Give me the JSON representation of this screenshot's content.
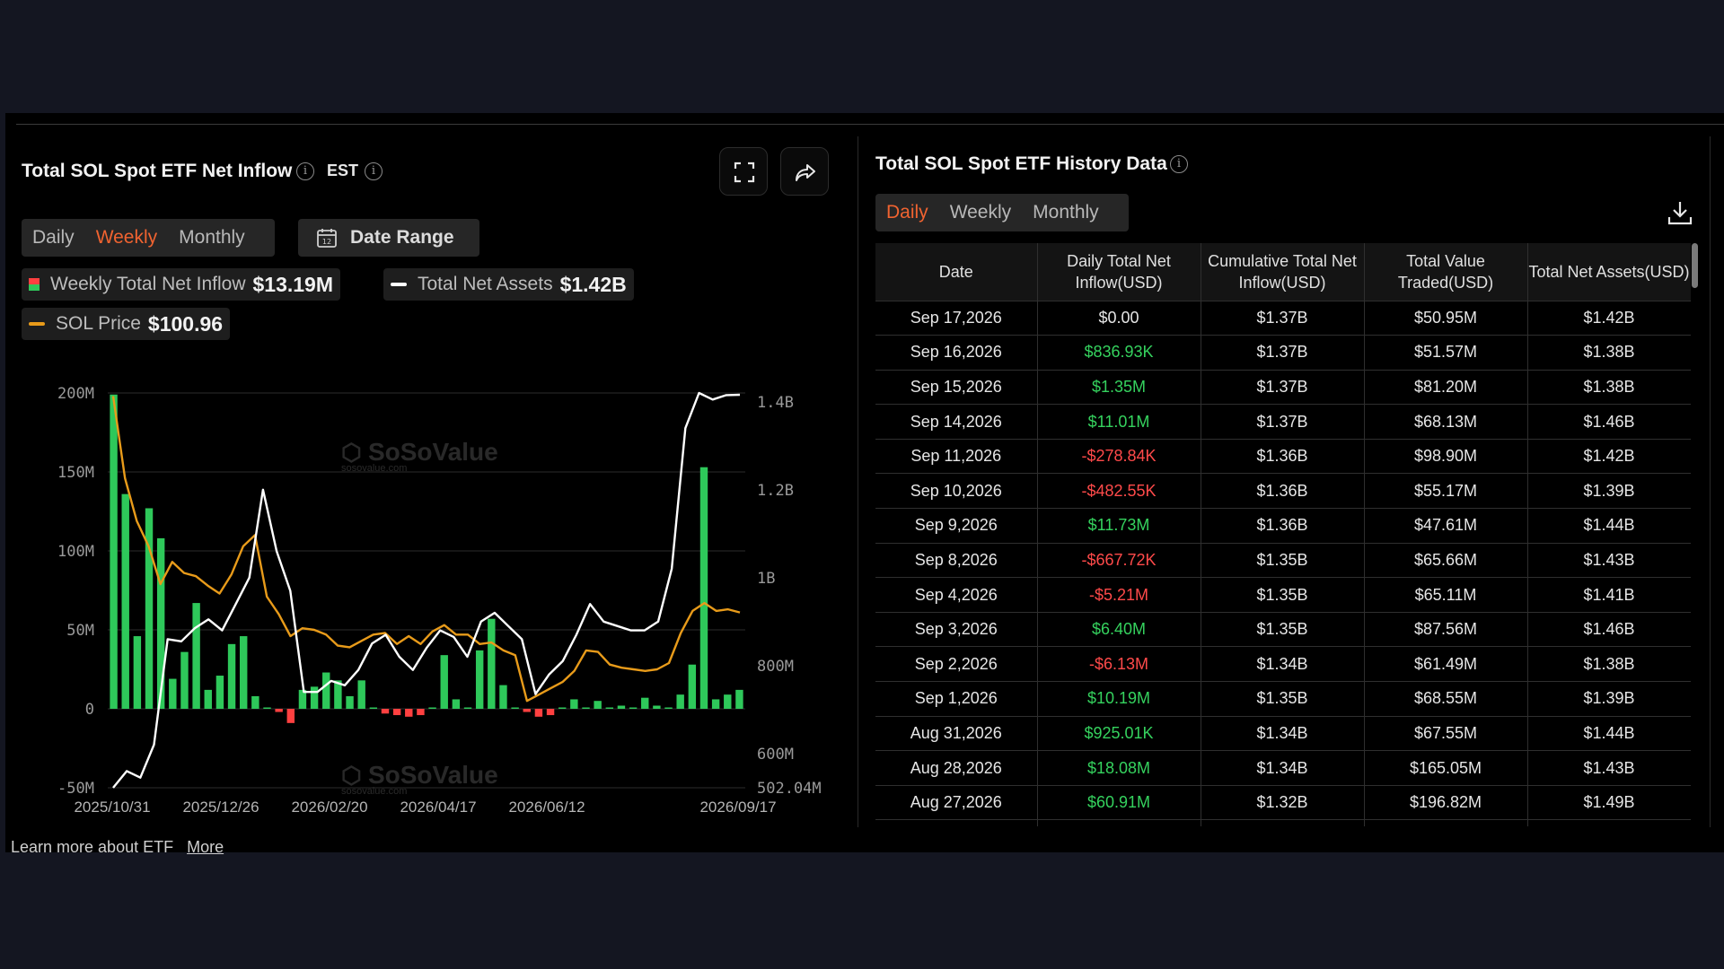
{
  "left_panel": {
    "title": "Total SOL Spot ETF Net Inflow",
    "timezone": "EST",
    "tabs": [
      "Daily",
      "Weekly",
      "Monthly"
    ],
    "active_tab": "Weekly",
    "date_range_label": "Date Range",
    "legend": {
      "inflow_name": "Weekly Total Net Inflow",
      "inflow_value": "$13.19M",
      "assets_name": "Total Net Assets",
      "assets_value": "$1.42B",
      "price_name": "SOL Price",
      "price_value": "$100.96"
    },
    "watermark": "SoSoValue",
    "watermark_sub": "sosovalue.com"
  },
  "right_panel": {
    "title": "Total SOL Spot ETF History Data",
    "tabs": [
      "Daily",
      "Weekly",
      "Monthly"
    ],
    "active_tab": "Daily",
    "columns": [
      "Date",
      "Daily Total Net Inflow(USD)",
      "Cumulative Total Net Inflow(USD)",
      "Total Value Traded(USD)",
      "Total Net Assets(USD)"
    ],
    "rows": [
      [
        "Sep 17,2026",
        "$0.00",
        "$1.37B",
        "$50.95M",
        "$1.42B"
      ],
      [
        "Sep 16,2026",
        "$836.93K",
        "$1.37B",
        "$51.57M",
        "$1.38B"
      ],
      [
        "Sep 15,2026",
        "$1.35M",
        "$1.37B",
        "$81.20M",
        "$1.38B"
      ],
      [
        "Sep 14,2026",
        "$11.01M",
        "$1.37B",
        "$68.13M",
        "$1.46B"
      ],
      [
        "Sep 11,2026",
        "-$278.84K",
        "$1.36B",
        "$98.90M",
        "$1.42B"
      ],
      [
        "Sep 10,2026",
        "-$482.55K",
        "$1.36B",
        "$55.17M",
        "$1.39B"
      ],
      [
        "Sep 9,2026",
        "$11.73M",
        "$1.36B",
        "$47.61M",
        "$1.44B"
      ],
      [
        "Sep 8,2026",
        "-$667.72K",
        "$1.35B",
        "$65.66M",
        "$1.43B"
      ],
      [
        "Sep 4,2026",
        "-$5.21M",
        "$1.35B",
        "$65.11M",
        "$1.41B"
      ],
      [
        "Sep 3,2026",
        "$6.40M",
        "$1.35B",
        "$87.56M",
        "$1.46B"
      ],
      [
        "Sep 2,2026",
        "-$6.13M",
        "$1.34B",
        "$61.49M",
        "$1.38B"
      ],
      [
        "Sep 1,2026",
        "$10.19M",
        "$1.35B",
        "$68.55M",
        "$1.39B"
      ],
      [
        "Aug 31,2026",
        "$925.01K",
        "$1.34B",
        "$67.55M",
        "$1.44B"
      ],
      [
        "Aug 28,2026",
        "$18.08M",
        "$1.34B",
        "$165.05M",
        "$1.43B"
      ],
      [
        "Aug 27,2026",
        "$60.91M",
        "$1.32B",
        "$196.82M",
        "$1.49B"
      ],
      [
        "",
        "",
        "",
        "",
        ""
      ]
    ]
  },
  "footer": {
    "text": "Learn more about ETF",
    "link": "More"
  },
  "colors": {
    "positive": "#2ec85a",
    "negative": "#ff4040",
    "assets_line": "#ffffff",
    "price_line": "#e89b1a",
    "active_tab": "#f06330"
  },
  "chart_data": {
    "type": "bar",
    "x_tick_labels": [
      "2025/10/31",
      "2025/12/26",
      "2026/02/20",
      "2026/04/17",
      "2026/06/12",
      "2026/09/17"
    ],
    "y_left_ticks": [
      "200M",
      "150M",
      "100M",
      "50M",
      "0",
      "-50M"
    ],
    "y_left_range": [
      -50,
      200
    ],
    "y_right_ticks": [
      "1.4B",
      "1.2B",
      "1B",
      "800M",
      "600M",
      "502.04M"
    ],
    "y_right_range_millions": [
      502.04,
      1400
    ],
    "grid": true,
    "series": [
      {
        "name": "Weekly Total Net Inflow",
        "kind": "bar",
        "unit": "M USD",
        "values": [
          199,
          136,
          46,
          127,
          108,
          19,
          36,
          67,
          12,
          21,
          41,
          46,
          8,
          0,
          -2,
          -9,
          12,
          14,
          23,
          18,
          8,
          18,
          0,
          -3,
          -4,
          -5,
          -4,
          0,
          34,
          6,
          0,
          37,
          57,
          15,
          0,
          -2,
          -5,
          -4,
          0,
          6,
          0,
          5,
          0,
          2,
          0,
          7,
          2,
          0,
          9,
          28,
          153,
          6,
          9,
          12
        ]
      },
      {
        "name": "Total Net Assets",
        "kind": "line",
        "unit": "M USD",
        "values": [
          502,
          540,
          525,
          600,
          840,
          835,
          865,
          885,
          860,
          920,
          980,
          1180,
          1040,
          950,
          720,
          720,
          745,
          735,
          770,
          830,
          850,
          800,
          770,
          820,
          860,
          845,
          800,
          880,
          900,
          870,
          840,
          715,
          760,
          790,
          850,
          920,
          880,
          870,
          860,
          860,
          880,
          1000,
          1320,
          1400,
          1385,
          1395,
          1396
        ]
      },
      {
        "name": "SOL Price",
        "kind": "line",
        "unit": "USD",
        "values": [
          198,
          146,
          119,
          103,
          79,
          93,
          86,
          84,
          78,
          73,
          85,
          103,
          110,
          71,
          60,
          46,
          51,
          50,
          47,
          40,
          39,
          43,
          47,
          48,
          41,
          46,
          41,
          49,
          53,
          47,
          47,
          41,
          42,
          37,
          34,
          5,
          9,
          13,
          17,
          24,
          37,
          36,
          28,
          26,
          25,
          24,
          25,
          29,
          48,
          62,
          67,
          62,
          63,
          61
        ]
      }
    ]
  }
}
